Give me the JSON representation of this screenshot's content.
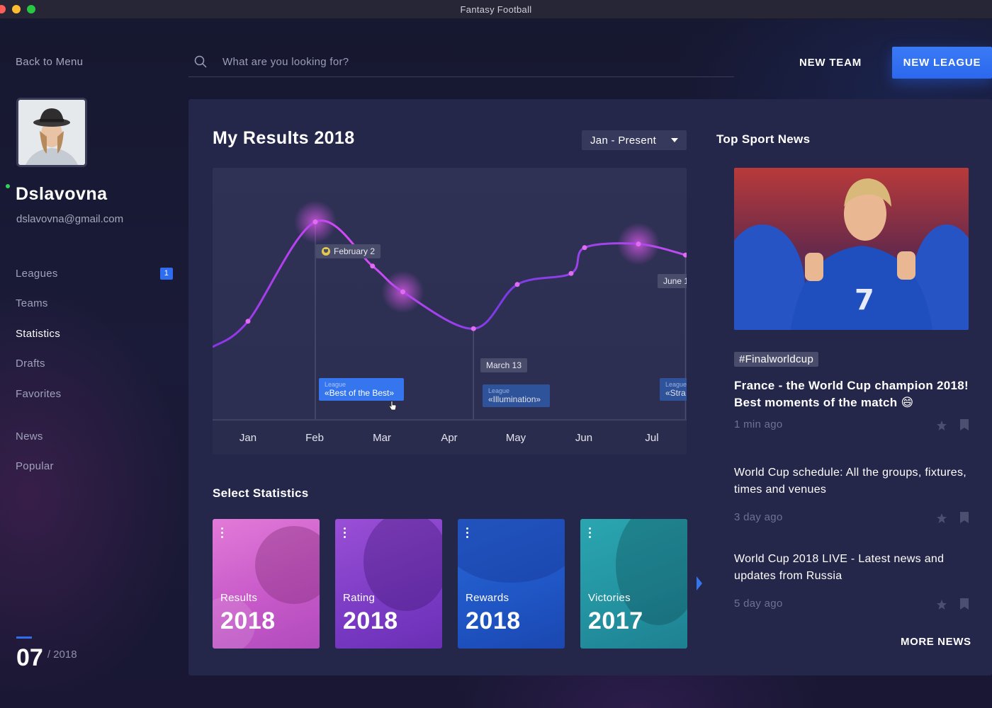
{
  "window": {
    "title": "Fantasy Football"
  },
  "sidebar": {
    "back_label": "Back to Menu",
    "user": {
      "name": "Dslavovna",
      "email": "dslavovna@gmail.com"
    },
    "items": [
      {
        "label": "Leagues",
        "badge": "1"
      },
      {
        "label": "Teams"
      },
      {
        "label": "Statistics",
        "active": true
      },
      {
        "label": "Drafts"
      },
      {
        "label": "Favorites"
      }
    ],
    "items2": [
      {
        "label": "News"
      },
      {
        "label": "Popular"
      }
    ],
    "date": {
      "month": "07",
      "year": "/ 2018"
    }
  },
  "header": {
    "search_placeholder": "What are you looking for?",
    "new_team": "NEW TEAM",
    "new_league": "NEW LEAGUE"
  },
  "results": {
    "title": "My Results 2018",
    "range": "Jan - Present",
    "markers": {
      "feb": "February 2",
      "mar": "March 13",
      "jun": "June 1"
    },
    "leagues": [
      {
        "label": "League",
        "name": "«Best of the Best»"
      },
      {
        "label": "League",
        "name": "«Illumination»"
      },
      {
        "label": "League",
        "name": "«Stra"
      }
    ]
  },
  "chart_data": {
    "type": "line",
    "categories": [
      "Jan",
      "Feb",
      "Mar",
      "Apr",
      "May",
      "Jun",
      "Jul"
    ],
    "series": [
      {
        "values": [
          0.32,
          0.86,
          0.62,
          0.48,
          0.28,
          0.52,
          0.58,
          0.72,
          0.74,
          0.68
        ]
      }
    ],
    "x": [
      0.0,
      1.0,
      1.85,
      2.3,
      3.35,
      4.0,
      4.8,
      5.0,
      5.8,
      6.5
    ],
    "xlabel": "",
    "ylabel": ""
  },
  "stats": {
    "title": "Select Statistics",
    "cards": [
      {
        "label": "Results",
        "year": "2018"
      },
      {
        "label": "Rating",
        "year": "2018"
      },
      {
        "label": "Rewards",
        "year": "2018"
      },
      {
        "label": "Victories",
        "year": "2017"
      }
    ]
  },
  "news": {
    "title": "Top Sport News",
    "hashtag": "#Finalworldcup",
    "items": [
      {
        "headline": "France - the World Cup champion 2018! Best moments of the match 😄",
        "time": "1 min ago"
      },
      {
        "headline": "World Cup schedule: All the groups, fixtures, times and venues",
        "time": "3 day ago"
      },
      {
        "headline": "World Cup 2018 LIVE - Latest news and updates from Russia",
        "time": "5 day ago"
      }
    ],
    "more": "MORE NEWS"
  },
  "colors": {
    "accent": "#2f6df0",
    "line": "#b43df0",
    "panel": "#24264a"
  }
}
